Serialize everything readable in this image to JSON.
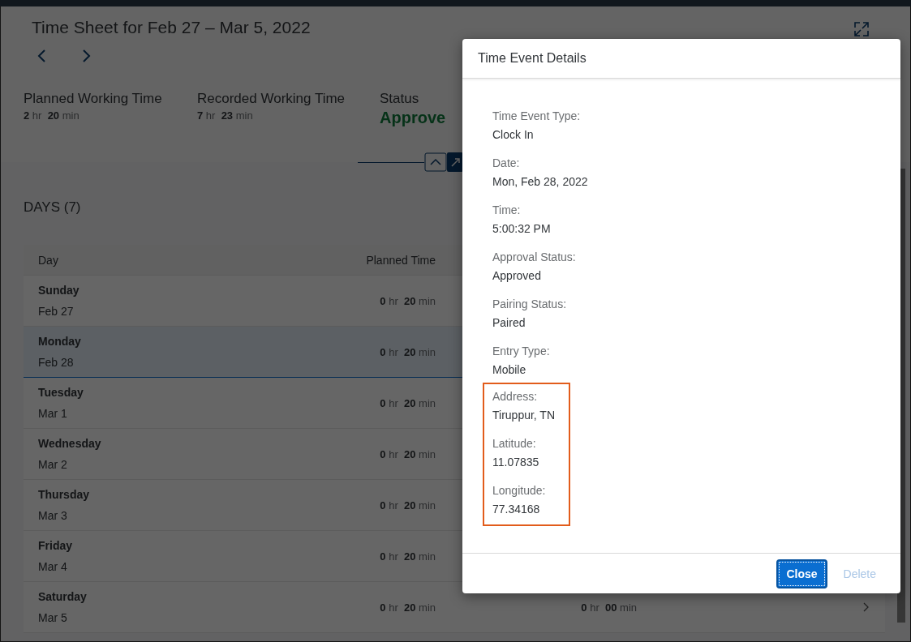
{
  "page": {
    "title": "Time Sheet for Feb 27 – Mar 5, 2022",
    "kpis": [
      {
        "label": "Planned Working Time",
        "hours": "2",
        "hr_unit": "hr",
        "minutes": "20",
        "min_unit": "min",
        "kind": "duration"
      },
      {
        "label": "Recorded Working Time",
        "hours": "7",
        "hr_unit": "hr",
        "minutes": "23",
        "min_unit": "min",
        "kind": "duration"
      },
      {
        "label": "Status",
        "value": "Approve",
        "kind": "status"
      }
    ],
    "days_title": "DAYS (7)",
    "table": {
      "columns": [
        "Day",
        "Planned Time"
      ],
      "rows": [
        {
          "day": "Sunday",
          "date": "Feb 27",
          "planned": [
            "0",
            "hr",
            "20",
            "min"
          ],
          "selected": false
        },
        {
          "day": "Monday",
          "date": "Feb 28",
          "planned": [
            "0",
            "hr",
            "20",
            "min"
          ],
          "selected": true
        },
        {
          "day": "Tuesday",
          "date": "Mar 1",
          "planned": [
            "0",
            "hr",
            "20",
            "min"
          ],
          "selected": false
        },
        {
          "day": "Wednesday",
          "date": "Mar 2",
          "planned": [
            "0",
            "hr",
            "20",
            "min"
          ],
          "selected": false
        },
        {
          "day": "Thursday",
          "date": "Mar 3",
          "planned": [
            "0",
            "hr",
            "20",
            "min"
          ],
          "selected": false
        },
        {
          "day": "Friday",
          "date": "Mar 4",
          "planned": [
            "0",
            "hr",
            "20",
            "min"
          ],
          "selected": false
        },
        {
          "day": "Saturday",
          "date": "Mar 5",
          "planned": [
            "0",
            "hr",
            "20",
            "min"
          ],
          "recorded": [
            "0",
            "hr",
            "00",
            "min"
          ],
          "selected": false
        }
      ]
    }
  },
  "dialog": {
    "title": "Time Event Details",
    "fields": [
      {
        "label": "Time Event Type:",
        "value": "Clock In"
      },
      {
        "label": "Date:",
        "value": "Mon, Feb 28, 2022"
      },
      {
        "label": "Time:",
        "value": "5:00:32 PM"
      },
      {
        "label": "Approval Status:",
        "value": "Approved"
      },
      {
        "label": "Pairing Status:",
        "value": "Paired"
      },
      {
        "label": "Entry Type:",
        "value": "Mobile"
      }
    ],
    "highlighted_fields": [
      {
        "label": "Address:",
        "value": "Tiruppur, TN"
      },
      {
        "label": "Latitude:",
        "value": "11.07835"
      },
      {
        "label": "Longitude:",
        "value": "77.34168"
      }
    ],
    "buttons": [
      {
        "label": "Close",
        "kind": "primary",
        "disabled": false
      },
      {
        "label": "Delete",
        "kind": "secondary",
        "disabled": true
      }
    ]
  }
}
